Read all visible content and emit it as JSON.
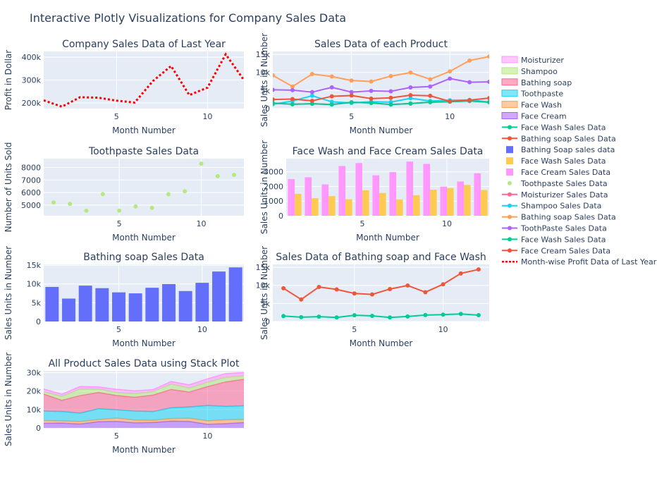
{
  "figure_title": "Interactive Plotly Visualizations for Company Sales Data",
  "colors": {
    "plot_bg": "#e5ecf6",
    "grid": "#ffffff",
    "text": "#2a3f5f",
    "moisturizer": "#EF553B",
    "shampoo": "#00CC96",
    "bathing_soap": "#636EFA",
    "toothpaste": "#AB63FA",
    "face_wash": "#FFA15A",
    "face_cream": "#19D3F3",
    "facewash_line": "#00CC96",
    "bathing_line": "#EF553B",
    "profit": "#ff0000"
  },
  "legend": {
    "items": [
      {
        "label": "Moisturizer",
        "kind": "area",
        "color": "#FF97FF"
      },
      {
        "label": "Shampoo",
        "kind": "area",
        "color": "#B6E880"
      },
      {
        "label": "Bathing soap",
        "kind": "area",
        "color": "#FF6692"
      },
      {
        "label": "Toothpaste",
        "kind": "area",
        "color": "#19D3F3"
      },
      {
        "label": "Face Wash",
        "kind": "area",
        "color": "#FFA15A"
      },
      {
        "label": "Face Cream",
        "kind": "area",
        "color": "#AB63FA"
      },
      {
        "label": "Face Wash Sales Data",
        "kind": "line-marker",
        "color": "#00CC96"
      },
      {
        "label": "Bathing soap Sales Data",
        "kind": "line-marker",
        "color": "#EF553B"
      },
      {
        "label": "Bathing Soap sales data",
        "kind": "bar",
        "color": "#636EFA"
      },
      {
        "label": "Face Wash Sales Data",
        "kind": "bar",
        "color": "#FECB52"
      },
      {
        "label": "Face Cream Sales Data",
        "kind": "bar",
        "color": "#FF97FF"
      },
      {
        "label": "Toothpaste Sales Data",
        "kind": "marker",
        "color": "#B6E880"
      },
      {
        "label": "Moisturizer Sales Data",
        "kind": "line-marker",
        "color": "#FF6692"
      },
      {
        "label": "Shampoo Sales Data",
        "kind": "line-marker",
        "color": "#19D3F3"
      },
      {
        "label": "Bathing soap Sales Data",
        "kind": "line-marker",
        "color": "#FF9F5A"
      },
      {
        "label": "ToothPaste Sales Data",
        "kind": "line-marker",
        "color": "#AB63FA"
      },
      {
        "label": "Face Wash Sales Data",
        "kind": "line-marker",
        "color": "#00CC96"
      },
      {
        "label": "Face Cream Sales Data",
        "kind": "line-marker",
        "color": "#EF553B"
      },
      {
        "label": "Month-wise Profit Data of Last Year",
        "kind": "dotted",
        "color": "#ff0000"
      }
    ]
  },
  "chart_data": [
    {
      "id": "profit",
      "type": "line",
      "title": "Company Sales Data of Last Year",
      "xlabel": "Month Number",
      "ylabel": "Profit in Dollar",
      "x": [
        1,
        2,
        3,
        4,
        5,
        6,
        7,
        8,
        9,
        10,
        11,
        12
      ],
      "series": [
        {
          "name": "Month-wise Profit Data of Last Year",
          "values": [
            211000,
            183300,
            224700,
            222700,
            209600,
            201400,
            295500,
            361400,
            234000,
            266700,
            412800,
            300200
          ],
          "color": "#ff0000",
          "style": "dotted"
        }
      ],
      "xlim": [
        1,
        12
      ],
      "ylim": [
        175000,
        425000
      ],
      "xticks": [
        5,
        10
      ],
      "yticks": [
        200000,
        300000,
        400000
      ],
      "ytick_labels": [
        "200k",
        "300k",
        "400k"
      ]
    },
    {
      "id": "products",
      "type": "line",
      "title": "Sales Data of each Product",
      "xlabel": "Month Number",
      "ylabel": "Sales Units in Number",
      "x": [
        1,
        2,
        3,
        4,
        5,
        6,
        7,
        8,
        9,
        10,
        11,
        12
      ],
      "series": [
        {
          "name": "Moisturizer Sales Data",
          "values": [
            1500,
            1200,
            1340,
            1130,
            1740,
            1555,
            1120,
            1400,
            1780,
            1890,
            2100,
            1760
          ],
          "color": "#FF6692"
        },
        {
          "name": "Shampoo Sales Data",
          "values": [
            1200,
            2100,
            3550,
            1870,
            1560,
            1890,
            1780,
            2860,
            2100,
            2300,
            2400,
            1800
          ],
          "color": "#19D3F3"
        },
        {
          "name": "Bathing soap Sales Data",
          "values": [
            9200,
            6100,
            9550,
            8870,
            7760,
            7490,
            8980,
            9960,
            8100,
            10300,
            13300,
            14400
          ],
          "color": "#FF9F5A"
        },
        {
          "name": "ToothPaste Sales Data",
          "values": [
            5200,
            5100,
            4550,
            5870,
            4560,
            4890,
            4780,
            5860,
            6100,
            8300,
            7300,
            7400
          ],
          "color": "#AB63FA"
        },
        {
          "name": "Face Wash Sales Data",
          "values": [
            1500,
            1200,
            1340,
            1130,
            1740,
            1555,
            1120,
            1400,
            1780,
            1890,
            2100,
            1760
          ],
          "color": "#00CC96"
        },
        {
          "name": "Face Cream Sales Data",
          "values": [
            2500,
            2630,
            2140,
            3400,
            3600,
            2760,
            2980,
            3700,
            3540,
            1990,
            2340,
            2900
          ],
          "color": "#EF553B"
        }
      ],
      "xlim": [
        1,
        12
      ],
      "ylim": [
        0,
        15800
      ],
      "xticks": [
        5,
        10
      ],
      "yticks": [
        0,
        5000,
        10000,
        15000
      ],
      "ytick_labels": [
        "0",
        "5k",
        "10k",
        "15k"
      ]
    },
    {
      "id": "toothpaste",
      "type": "scatter",
      "title": "Toothpaste Sales Data",
      "xlabel": "Month Number",
      "ylabel": "Number of Units Sold",
      "x": [
        1,
        2,
        3,
        4,
        5,
        6,
        7,
        8,
        9,
        10,
        11,
        12
      ],
      "series": [
        {
          "name": "Toothpaste Sales Data",
          "values": [
            5200,
            5100,
            4550,
            5870,
            4560,
            4890,
            4780,
            5860,
            6100,
            8300,
            7300,
            7400
          ],
          "color": "#B6E880"
        }
      ],
      "xlim": [
        0.4,
        12.6
      ],
      "ylim": [
        4150,
        8700
      ],
      "xticks": [
        5,
        10
      ],
      "yticks": [
        5000,
        6000,
        7000,
        8000
      ],
      "ytick_labels": [
        "5000",
        "6000",
        "7000",
        "8000"
      ]
    },
    {
      "id": "facewash_cream",
      "type": "bar",
      "title": "Face Wash and Face Cream Sales Data",
      "xlabel": "Month Number",
      "ylabel": "Sales Units in Number",
      "x": [
        1,
        2,
        3,
        4,
        5,
        6,
        7,
        8,
        9,
        10,
        11,
        12
      ],
      "series": [
        {
          "name": "Face Cream Sales Data",
          "values": [
            2500,
            2630,
            2140,
            3400,
            3600,
            2760,
            2980,
            3700,
            3540,
            1990,
            2340,
            2900
          ],
          "color": "#FF97FF"
        },
        {
          "name": "Face Wash Sales Data",
          "values": [
            1500,
            1200,
            1340,
            1130,
            1740,
            1555,
            1120,
            1400,
            1780,
            1890,
            2100,
            1760
          ],
          "color": "#FECB52"
        }
      ],
      "xlim": [
        0.5,
        12.5
      ],
      "ylim": [
        0,
        3900
      ],
      "xticks": [
        5,
        10
      ],
      "yticks": [
        0,
        1000,
        2000,
        3000
      ],
      "ytick_labels": [
        "0",
        "1000",
        "2000",
        "3000"
      ]
    },
    {
      "id": "bathing",
      "type": "bar",
      "title": "Bathing soap Sales Data",
      "xlabel": "Month Number",
      "ylabel": "Sales Units in Number",
      "x": [
        1,
        2,
        3,
        4,
        5,
        6,
        7,
        8,
        9,
        10,
        11,
        12
      ],
      "series": [
        {
          "name": "Bathing Soap sales data",
          "values": [
            9200,
            6100,
            9550,
            8870,
            7760,
            7490,
            8980,
            9960,
            8100,
            10300,
            13300,
            14400
          ],
          "color": "#636EFA"
        }
      ],
      "xlim": [
        0.5,
        12.5
      ],
      "ylim": [
        0,
        15200
      ],
      "xticks": [
        5,
        10
      ],
      "yticks": [
        0,
        5000,
        10000,
        15000
      ],
      "ytick_labels": [
        "0",
        "5k",
        "10k",
        "15k"
      ]
    },
    {
      "id": "bathing_facewash",
      "type": "line",
      "title": "Sales Data of Bathing soap and Face Wash",
      "xlabel": "Month Number",
      "ylabel": "Sales Units in Number",
      "x": [
        1,
        2,
        3,
        4,
        5,
        6,
        7,
        8,
        9,
        10,
        11,
        12
      ],
      "series": [
        {
          "name": "Face Wash Sales Data",
          "values": [
            1500,
            1200,
            1340,
            1130,
            1740,
            1555,
            1120,
            1400,
            1780,
            1890,
            2100,
            1760
          ],
          "color": "#00CC96"
        },
        {
          "name": "Bathing soap Sales Data",
          "values": [
            9200,
            6100,
            9550,
            8870,
            7760,
            7490,
            8980,
            9960,
            8100,
            10300,
            13300,
            14400
          ],
          "color": "#EF553B"
        }
      ],
      "xlim": [
        0.4,
        12.6
      ],
      "ylim": [
        0,
        15800
      ],
      "xticks": [
        5,
        10
      ],
      "yticks": [
        0,
        5000,
        10000,
        15000
      ],
      "ytick_labels": [
        "0",
        "5k",
        "10k",
        "15k"
      ]
    },
    {
      "id": "stack",
      "type": "area",
      "title": "All Product Sales Data using Stack Plot",
      "xlabel": "Month Number",
      "ylabel": "Sales Units in Number",
      "x": [
        1,
        2,
        3,
        4,
        5,
        6,
        7,
        8,
        9,
        10,
        11,
        12
      ],
      "series": [
        {
          "name": "Face Cream",
          "values": [
            2500,
            2630,
            2140,
            3400,
            3600,
            2760,
            2980,
            3700,
            3540,
            1990,
            2340,
            2900
          ],
          "color": "#AB63FA"
        },
        {
          "name": "Face Wash",
          "values": [
            1500,
            1200,
            1340,
            1130,
            1740,
            1555,
            1120,
            1400,
            1780,
            1890,
            2100,
            1760
          ],
          "color": "#FFA15A"
        },
        {
          "name": "Toothpaste",
          "values": [
            5200,
            5100,
            4550,
            5870,
            4560,
            4890,
            4780,
            5860,
            6100,
            8300,
            7300,
            7400
          ],
          "color": "#19D3F3"
        },
        {
          "name": "Bathing soap",
          "values": [
            9200,
            6100,
            9550,
            8870,
            7760,
            7490,
            8980,
            9960,
            8100,
            10300,
            13300,
            14400
          ],
          "color": "#FF6692"
        },
        {
          "name": "Shampoo",
          "values": [
            1200,
            2100,
            3550,
            1870,
            1560,
            1890,
            1780,
            2860,
            2100,
            2300,
            2400,
            1800
          ],
          "color": "#B6E880"
        },
        {
          "name": "Moisturizer",
          "values": [
            1500,
            1200,
            1340,
            1130,
            1740,
            1555,
            1120,
            1400,
            1780,
            1890,
            2100,
            1760
          ],
          "color": "#FF97FF"
        }
      ],
      "xlim": [
        1,
        12
      ],
      "ylim": [
        0,
        31000
      ],
      "xticks": [
        5,
        10
      ],
      "yticks": [
        0,
        10000,
        20000,
        30000
      ],
      "ytick_labels": [
        "0",
        "10k",
        "20k",
        "30k"
      ]
    }
  ]
}
